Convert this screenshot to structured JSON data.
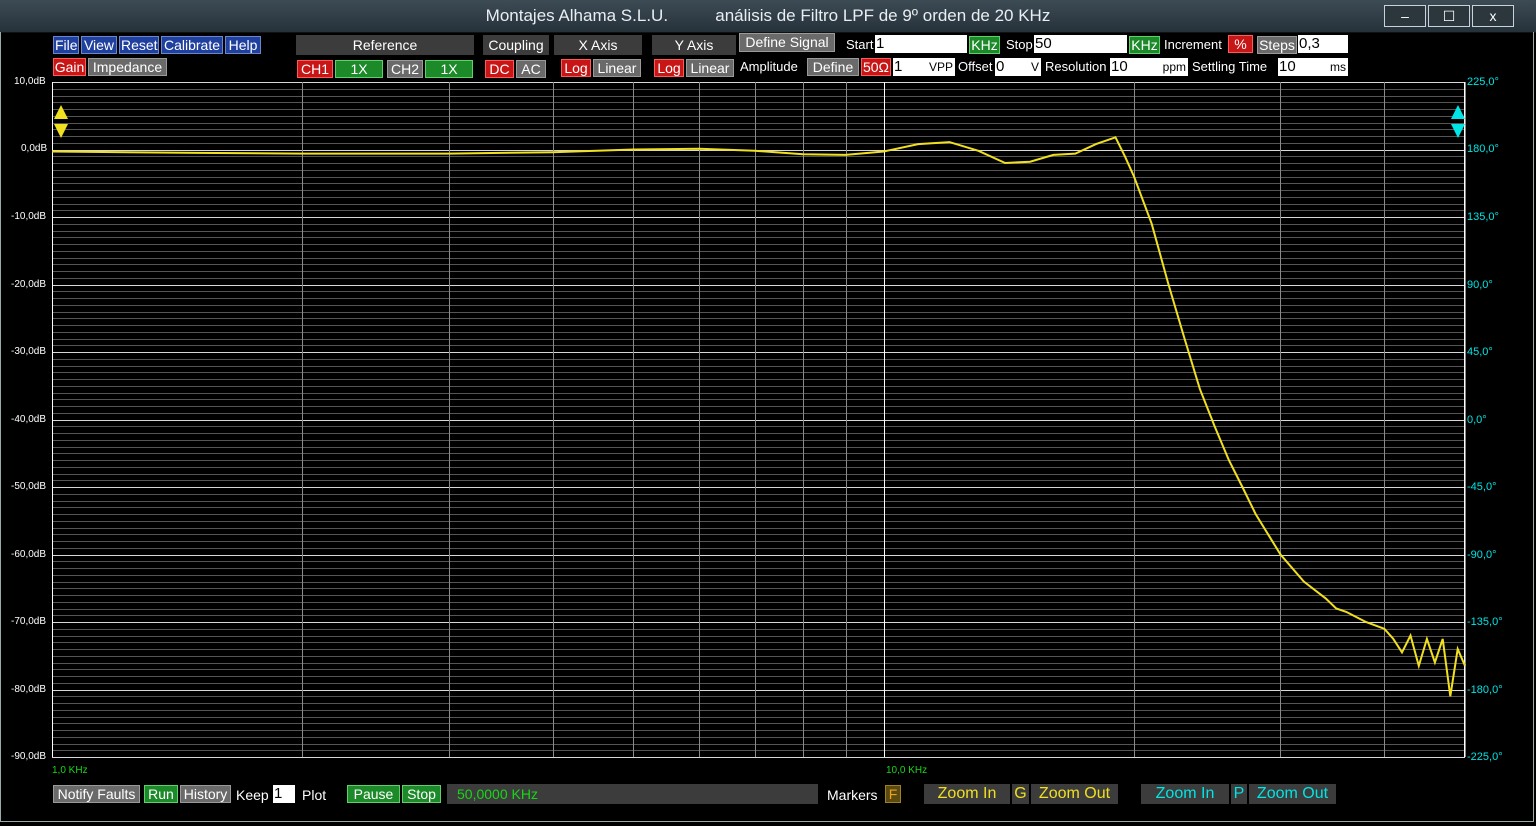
{
  "window": {
    "title": "Montajes Alhama S.L.U.          análisis de Filtro LPF de 9º orden de 20 KHz",
    "minimize": "–",
    "maximize": "☐",
    "close": "x"
  },
  "menu": [
    "File",
    "View",
    "Reset",
    "Calibrate",
    "Help"
  ],
  "mode": {
    "gain": "Gain",
    "impedance": "Impedance"
  },
  "headers": {
    "reference": "Reference",
    "coupling": "Coupling",
    "x_axis": "X Axis",
    "y_axis": "Y Axis",
    "define_signal": "Define Signal"
  },
  "reference": {
    "ch1": "CH1",
    "ch1_x": "1X",
    "ch2": "CH2",
    "ch2_x": "1X"
  },
  "coupling": {
    "dc": "DC",
    "ac": "AC"
  },
  "x_axis": {
    "log": "Log",
    "linear": "Linear"
  },
  "y_axis": {
    "log": "Log",
    "linear": "Linear"
  },
  "signal": {
    "start_label": "Start",
    "start_value": "1",
    "start_unit": "KHz",
    "stop_label": "Stop",
    "stop_value": "50",
    "stop_unit": "KHz",
    "increment_label": "Increment",
    "increment_mode": "%",
    "steps_label": "Steps",
    "steps_value": "0,3",
    "amplitude_label": "Amplitude",
    "define": "Define",
    "impedance": "50Ω",
    "amplitude_value": "1",
    "amplitude_unit": "VPP",
    "offset_label": "Offset",
    "offset_value": "0",
    "offset_unit": "V",
    "resolution_label": "Resolution",
    "resolution_value": "10",
    "resolution_unit": "ppm",
    "settling_label": "Settling Time",
    "settling_value": "10",
    "settling_unit": "ms"
  },
  "colors": {
    "trace": "#f0e020",
    "phase_axis": "#00e5e5",
    "freq_axis": "#17d817",
    "grid": "#7a7a7a"
  },
  "chart_data": {
    "type": "line",
    "x_scale": "log",
    "xlim_khz": [
      1,
      50
    ],
    "x_tick_labels": [
      "1,0 KHz",
      "10,0 KHz"
    ],
    "y_left_ticks": [
      "10,0dB",
      "0,0dB",
      "-10,0dB",
      "-20,0dB",
      "-30,0dB",
      "-40,0dB",
      "-50,0dB",
      "-60,0dB",
      "-70,0dB",
      "-80,0dB",
      "-90,0dB"
    ],
    "ylim_db": [
      -90,
      10
    ],
    "y_right_ticks": [
      "225,0°",
      "180,0°",
      "135,0°",
      "90,0°",
      "45,0°",
      "0,0°",
      "-45,0°",
      "-90,0°",
      "-135,0°",
      "-180,0°",
      "-225,0°"
    ],
    "series": [
      {
        "x_khz": [
          1.0,
          1.5,
          2.0,
          3.0,
          4.0,
          5.0,
          6.0,
          7.0,
          8.0,
          9.0,
          10.0,
          11.0,
          12.0,
          13.0,
          14.0,
          15.0,
          16.0,
          17.0,
          18.0,
          19.0,
          19.5,
          20.0,
          21.0,
          22.0,
          23.0,
          24.0,
          25.0,
          26.0,
          27.0,
          28.0,
          30.0,
          32.0,
          34.0,
          35.0,
          36.0,
          38.0,
          40.0,
          41.0,
          42.0,
          43.0,
          44.0,
          45.0,
          46.0,
          47.0,
          48.0,
          49.0,
          50.0
        ],
        "gain_db": [
          -0.3,
          -0.5,
          -0.6,
          -0.6,
          -0.4,
          0.0,
          0.1,
          -0.2,
          -0.7,
          -0.8,
          -0.3,
          0.8,
          1.1,
          -0.2,
          -2.0,
          -1.8,
          -0.8,
          -0.6,
          0.8,
          1.8,
          -1.0,
          -4.0,
          -11.0,
          -20.0,
          -28.0,
          -35.5,
          -41.0,
          -46.0,
          -50.0,
          -54.0,
          -60.0,
          -64.0,
          -66.5,
          -68.0,
          -68.5,
          -70.0,
          -71.0,
          -72.5,
          -74.5,
          -72.0,
          -76.5,
          -72.5,
          -76.0,
          -72.5,
          -81.0,
          -74.0,
          -76.5
        ]
      }
    ]
  },
  "bottom": {
    "notify_faults": "Notify Faults",
    "run": "Run",
    "history": "History",
    "keep_label": "Keep",
    "keep_value": "1",
    "plot_label": "Plot",
    "pause": "Pause",
    "stop": "Stop",
    "status": "50,0000 KHz",
    "markers_label": "Markers",
    "markers_value": "F",
    "zoom_in": "Zoom In",
    "g": "G",
    "zoom_out": "Zoom Out",
    "zoom_in2": "Zoom In",
    "p": "P",
    "zoom_out2": "Zoom Out"
  }
}
